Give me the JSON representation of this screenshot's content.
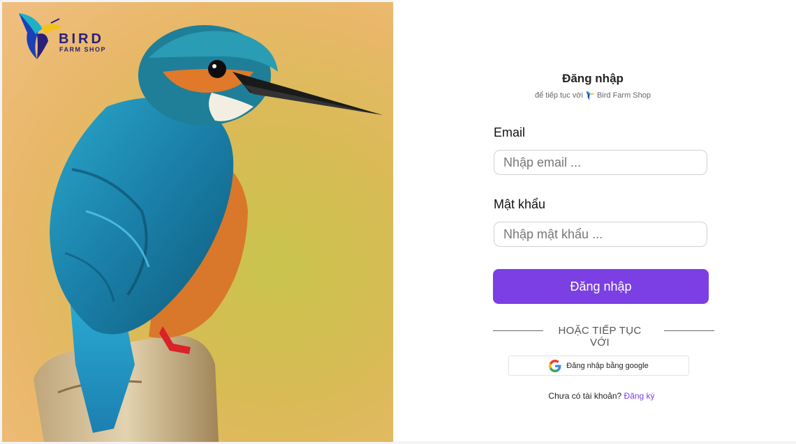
{
  "brand": {
    "name": "BIRD",
    "tagline": "FARM SHOP",
    "logo_icon": "hummingbird-logo"
  },
  "hero": {
    "image": "kingfisher-photo"
  },
  "login": {
    "title": "Đăng nhập",
    "subtitle_prefix": "để tiếp tục với",
    "subtitle_brand": "Bird Farm Shop",
    "email_label": "Email",
    "email_placeholder": "Nhập email ...",
    "email_value": "",
    "password_label": "Mật khẩu",
    "password_placeholder": "Nhập mật khẩu ...",
    "password_value": "",
    "submit_label": "Đăng nhập",
    "divider_text": "HOẶC TIẾP TỤC VỚI",
    "google_label": "Đăng nhập bằng google",
    "google_icon": "google-icon",
    "signup_prompt": "Chưa có tài khoản?",
    "signup_link": "Đăng ký"
  },
  "colors": {
    "accent": "#7b3fe4",
    "brand_text": "#2a1f7a"
  }
}
